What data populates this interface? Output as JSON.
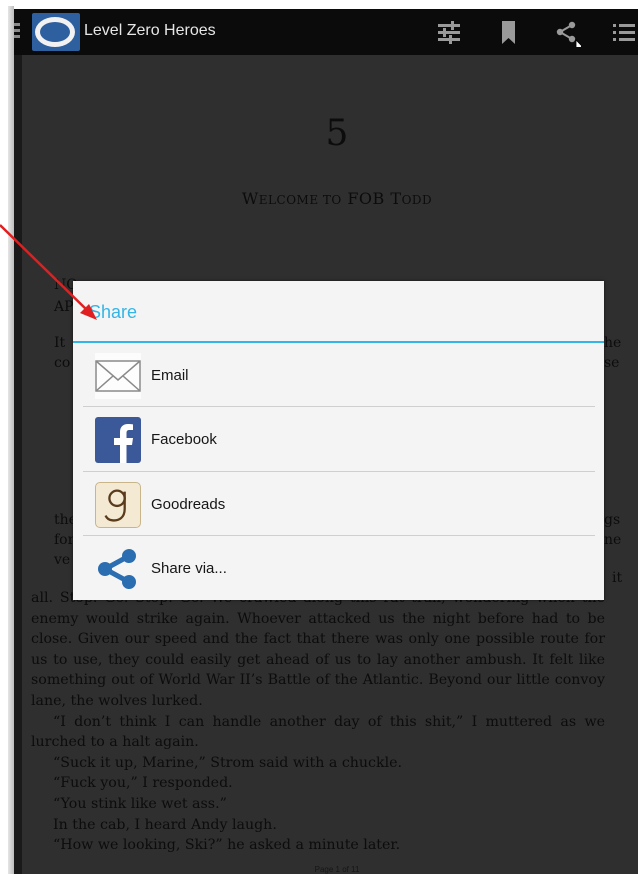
{
  "app": {
    "title": "Level Zero Heroes"
  },
  "toolbar": {
    "icons": [
      "sliders-icon",
      "bookmark-icon",
      "share-icon",
      "list-icon"
    ]
  },
  "book": {
    "chapter_number": "5",
    "chapter_title_cap1": "W",
    "chapter_title_small1": "ELCOME TO",
    "chapter_title_word": " FOB T",
    "chapter_title_small2": "ODD",
    "left_fragments": [
      "NO",
      "AP",
      "It",
      "co",
      "the",
      "for",
      "ve"
    ],
    "right_fragments": [
      "he",
      "se",
      "gs",
      "ne",
      "it"
    ],
    "paragraphs": [
      "all. Stop. Go. Stop. Go. We crawled along this rat trail, wondering when the enemy would strike again. Whoever attacked us the night before had to be close. Given our speed and the fact that there was only one possible route for us to use, they could easily get ahead of us to lay another ambush. It felt like something out of World War II’s Battle of the Atlantic. Beyond our little convoy lane, the wolves lurked.",
      "“I don’t think I can handle another day of this shit,” I muttered as we lurched to a halt again.",
      "“Suck it up, Marine,” Strom said with a chuckle.",
      "“Fuck you,” I responded.",
      "“You stink like wet ass.”",
      "In the cab, I heard Andy laugh.",
      "“How we looking, Ski?” he asked a minute later."
    ],
    "page_indicator": "Page 1 of 11"
  },
  "share_dialog": {
    "title": "Share",
    "items": [
      {
        "label": "Email",
        "icon": "email-icon"
      },
      {
        "label": "Facebook",
        "icon": "facebook-icon"
      },
      {
        "label": "Goodreads",
        "icon": "goodreads-icon"
      },
      {
        "label": "Share via...",
        "icon": "share-icon"
      }
    ]
  },
  "colors": {
    "accent": "#33b5e5",
    "annotation": "#e02020",
    "facebook": "#3b5998",
    "share_icon": "#2a6db0"
  }
}
